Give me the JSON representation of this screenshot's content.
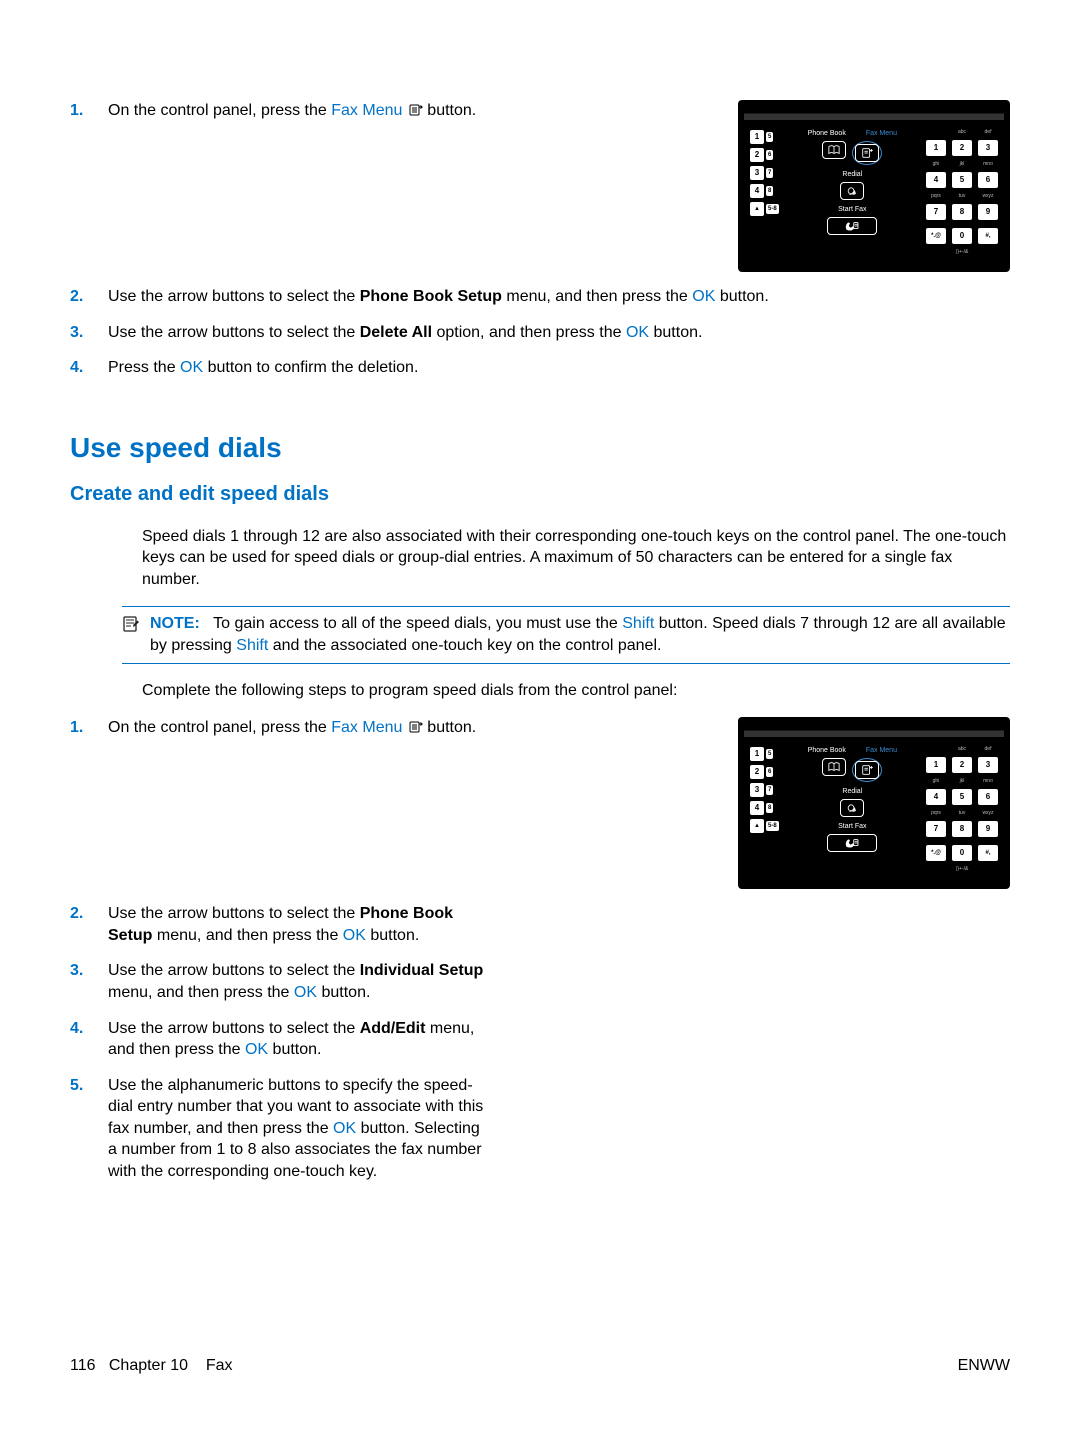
{
  "link_labels": {
    "fax_menu": "Fax Menu",
    "ok": "OK",
    "shift": "Shift"
  },
  "section1": {
    "step1_a": "On the control panel, press the ",
    "step1_b": " button.",
    "step2_a": "Use the arrow buttons to select the ",
    "step2_bold": "Phone Book Setup",
    "step2_b": " menu, and then press the ",
    "step2_c": " button.",
    "step3_a": "Use the arrow buttons to select the ",
    "step3_bold": "Delete All",
    "step3_b": " option, and then press the ",
    "step3_c": " button.",
    "step4_a": "Press the ",
    "step4_b": " button to confirm the deletion."
  },
  "heading": "Use speed dials",
  "subheading": "Create and edit speed dials",
  "intro": "Speed dials 1 through 12 are also associated with their corresponding one-touch keys on the control panel. The one-touch keys can be used for speed dials or group-dial entries. A maximum of 50 characters can be entered for a single fax number.",
  "note": {
    "label": "NOTE:",
    "text_a": "To gain access to all of the speed dials, you must use the ",
    "text_b": " button. Speed dials 7 through 12 are all available by pressing ",
    "text_c": " and the associated one-touch key on the control panel."
  },
  "intro2": "Complete the following steps to program speed dials from the control panel:",
  "section2": {
    "step1_a": "On the control panel, press the ",
    "step1_b": " button.",
    "step2_a": "Use the arrow buttons to select the ",
    "step2_bold": "Phone Book Setup",
    "step2_b": " menu, and then press the ",
    "step2_c": " button.",
    "step3_a": "Use the arrow buttons to select the ",
    "step3_bold": "Individual Setup",
    "step3_b": " menu, and then press the ",
    "step3_c": " button.",
    "step4_a": "Use the arrow buttons to select the ",
    "step4_bold": "Add/Edit",
    "step4_b": " menu, and then press the ",
    "step4_c": " button.",
    "step5_a": "Use the alphanumeric buttons to specify the speed-dial entry number that you want to associate with this fax number, and then press the ",
    "step5_b": " button. Selecting a number from 1 to 8 also associates the fax number with the corresponding one-touch key."
  },
  "footer": {
    "left_page": "116",
    "left_chapter": "Chapter 10",
    "left_title": "Fax",
    "right": "ENWW"
  },
  "panel": {
    "labels": {
      "phone_book": "Phone Book",
      "fax_menu": "Fax Menu",
      "redial": "Redial",
      "start_fax": "Start Fax"
    },
    "speed": [
      "1",
      "2",
      "3",
      "4"
    ],
    "speed_alt": [
      "5",
      "6",
      "7",
      "8"
    ],
    "shift_label": "5-8",
    "keypad_letters": [
      "",
      "abc",
      "def",
      "ghi",
      "jkl",
      "mno",
      "pqrs",
      "tuv",
      "wxyz"
    ],
    "keypad": [
      "1",
      "2",
      "3",
      "4",
      "5",
      "6",
      "7",
      "8",
      "9",
      "*.@",
      "0",
      "#,"
    ],
    "sym_label": "()+-/&"
  }
}
